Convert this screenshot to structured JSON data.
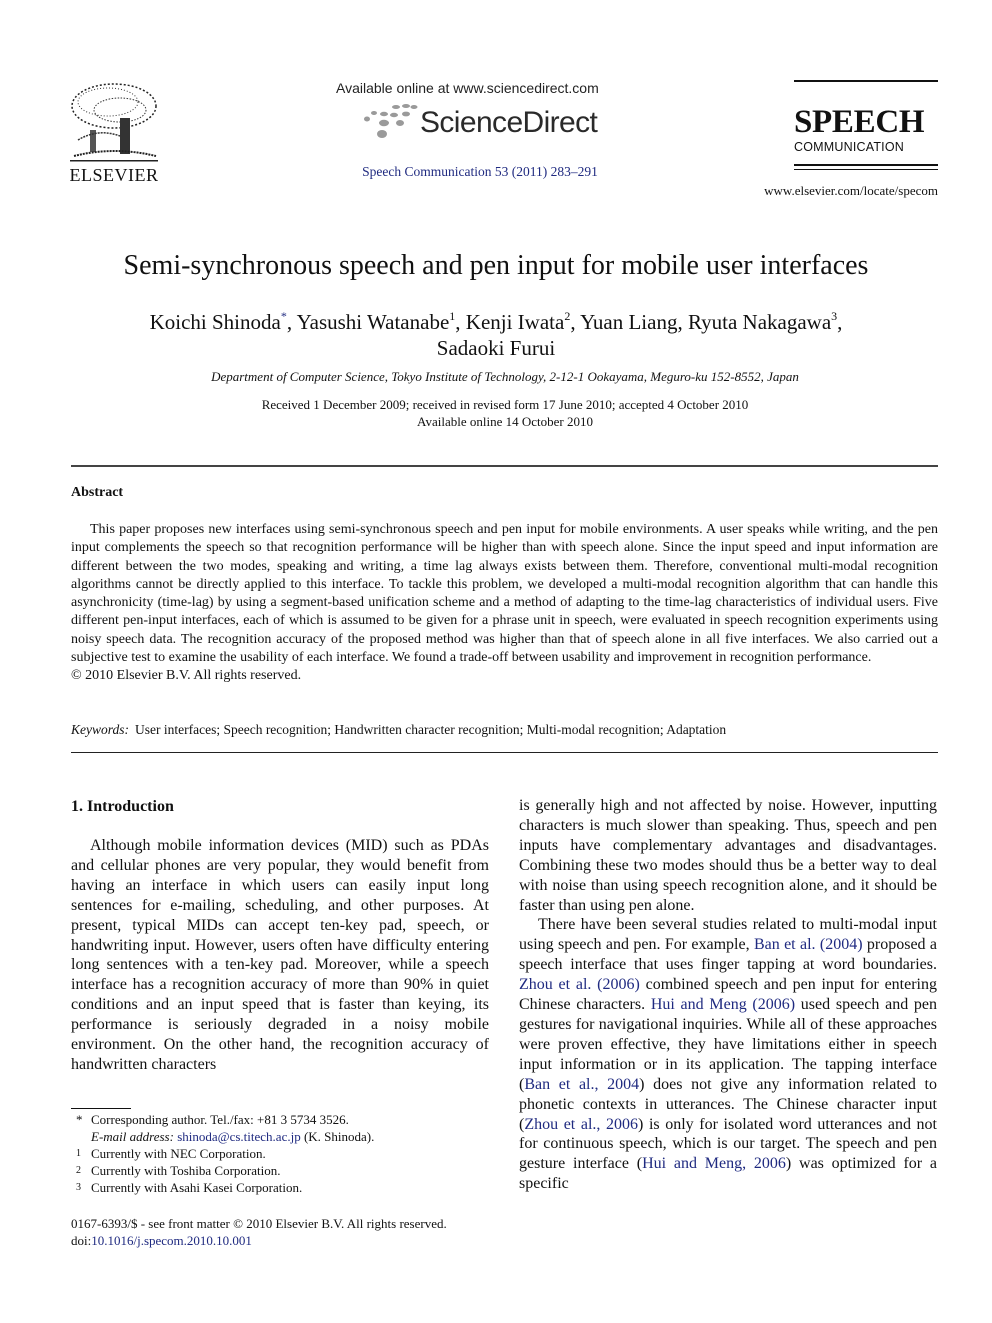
{
  "header": {
    "publisher": "ELSEVIER",
    "available_online": "Available online at www.sciencedirect.com",
    "sciencedirect_brand": "ScienceDirect",
    "journal_citation": "Speech Communication 53 (2011) 283–291",
    "journal_logo_title": "SPEECH",
    "journal_logo_subtitle": "COMMUNICATION",
    "journal_url": "www.elsevier.com/locate/specom",
    "link_color": "#1f2a80"
  },
  "article": {
    "title": "Semi-synchronous speech and pen input for mobile user interfaces",
    "authors": [
      {
        "name": "Koichi Shinoda",
        "mark": "*"
      },
      {
        "name": "Yasushi Watanabe",
        "mark": "1"
      },
      {
        "name": "Kenji Iwata",
        "mark": "2"
      },
      {
        "name": "Yuan Liang",
        "mark": ""
      },
      {
        "name": "Ryuta Nakagawa",
        "mark": "3"
      },
      {
        "name": "Sadaoki Furui",
        "mark": ""
      }
    ],
    "affiliation": "Department of Computer Science, Tokyo Institute of Technology, 2-12-1 Ookayama, Meguro-ku 152-8552, Japan",
    "received": "Received 1 December 2009; received in revised form 17 June 2010; accepted 4 October 2010",
    "available": "Available online 14 October 2010"
  },
  "abstract": {
    "heading": "Abstract",
    "body": "This paper proposes new interfaces using semi-synchronous speech and pen input for mobile environments. A user speaks while writing, and the pen input complements the speech so that recognition performance will be higher than with speech alone. Since the input speed and input information are different between the two modes, speaking and writing, a time lag always exists between them. Therefore, conventional multi-modal recognition algorithms cannot be directly applied to this interface. To tackle this problem, we developed a multi-modal recognition algorithm that can handle this asynchronicity (time-lag) by using a segment-based unification scheme and a method of adapting to the time-lag characteristics of individual users. Five different pen-input interfaces, each of which is assumed to be given for a phrase unit in speech, were evaluated in speech recognition experiments using noisy speech data. The recognition accuracy of the proposed method was higher than that of speech alone in all five interfaces. We also carried out a subjective test to examine the usability of each interface. We found a trade-off between usability and improvement in recognition performance.",
    "copyright": "© 2010 Elsevier B.V. All rights reserved.",
    "keywords_label": "Keywords:",
    "keywords": "User interfaces; Speech recognition; Handwritten character recognition; Multi-modal recognition; Adaptation"
  },
  "intro": {
    "heading": "1. Introduction",
    "left_para": "Although mobile information devices (MID) such as PDAs and cellular phones are very popular, they would benefit from having an interface in which users can easily input long sentences for e-mailing, scheduling, and other purposes. At present, typical MIDs can accept ten-key pad, speech, or handwriting input. However, users often have difficulty entering long sentences with a ten-key pad. Moreover, while a speech interface has a recognition accuracy of more than 90% in quiet conditions and an input speed that is faster than keying, its performance is seriously degraded in a noisy mobile environment. On the other hand, the recognition accuracy of handwritten characters",
    "right_para1": "is generally high and not affected by noise. However, inputting characters is much slower than speaking. Thus, speech and pen inputs have complementary advantages and disadvantages. Combining these two modes should thus be a better way to deal with noise than using speech recognition alone, and it should be faster than using pen alone.",
    "right_para2": {
      "t1": "There have been several studies related to multi-modal input using speech and pen. For example, ",
      "c1": "Ban et al. (2004)",
      "t2": " proposed a speech interface that uses finger tapping at word boundaries. ",
      "c2": "Zhou et al. (2006)",
      "t3": " combined speech and pen input for entering Chinese characters. ",
      "c3": "Hui and Meng (2006)",
      "t4": " used speech and pen gestures for navigational inquiries. While all of these approaches were proven effective, they have limitations either in speech input information or in its application. The tapping interface (",
      "c4": "Ban et al., 2004",
      "t5": ") does not give any information related to phonetic contexts in utterances. The Chinese character input (",
      "c5": "Zhou et al., 2006",
      "t6": ") is only for isolated word utterances and not for continuous speech, which is our target. The speech and pen gesture interface (",
      "c6": "Hui and Meng, 2006",
      "t7": ") was optimized for a specific"
    }
  },
  "footnotes": {
    "corresponding": "Corresponding author. Tel./fax: +81 3 5734 3526.",
    "email_label": "E-mail address:",
    "email": "shinoda@cs.titech.ac.jp",
    "email_suffix": " (K. Shinoda).",
    "notes": [
      {
        "mark": "1",
        "text": "Currently with NEC Corporation."
      },
      {
        "mark": "2",
        "text": "Currently with Toshiba Corporation."
      },
      {
        "mark": "3",
        "text": "Currently with Asahi Kasei Corporation."
      }
    ],
    "front_matter": "0167-6393/$ - see front matter © 2010 Elsevier B.V. All rights reserved.",
    "doi_prefix": "doi:",
    "doi": "10.1016/j.specom.2010.10.001"
  }
}
